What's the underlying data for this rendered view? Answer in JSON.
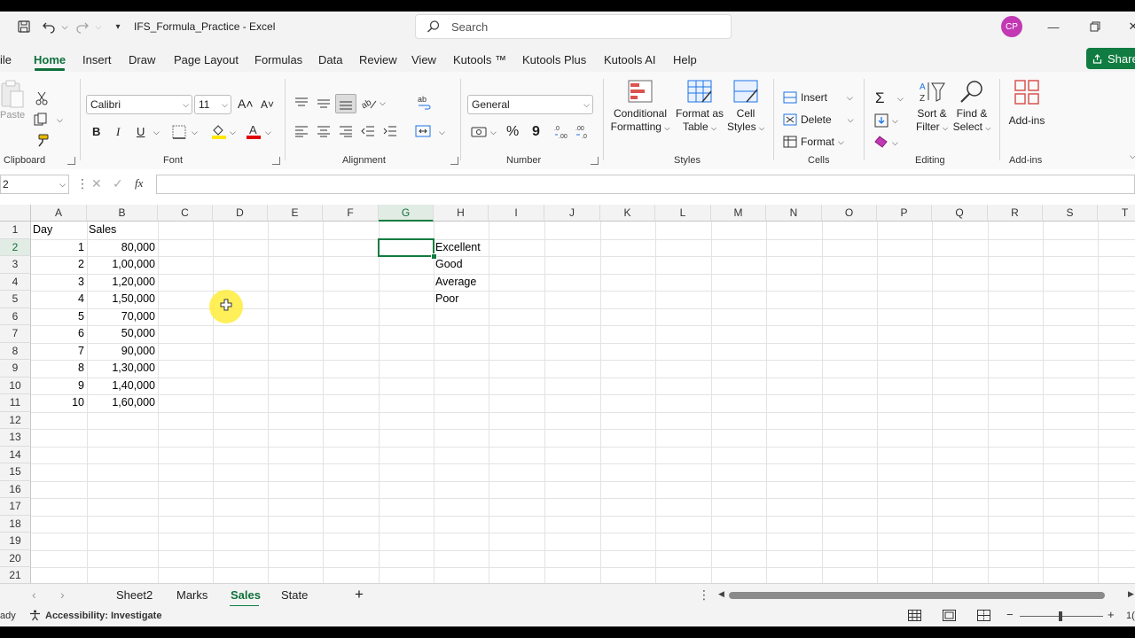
{
  "titlebar": {
    "doc_title": "IFS_Formula_Practice  -  Excel",
    "search_placeholder": "Search",
    "avatar_initials": "CP"
  },
  "menu": {
    "tabs": [
      "ile",
      "Home",
      "Insert",
      "Draw",
      "Page Layout",
      "Formulas",
      "Data",
      "Review",
      "View",
      "Kutools ™",
      "Kutools Plus",
      "Kutools AI",
      "Help"
    ],
    "active": "Home",
    "share_label": "Share"
  },
  "ribbon": {
    "clipboard": {
      "label": "Clipboard",
      "paste": "Paste"
    },
    "font": {
      "label": "Font",
      "name": "Calibri",
      "size": "11",
      "bold": "B",
      "italic": "I",
      "underline": "U",
      "grow": "A˄",
      "shrink": "A˅"
    },
    "alignment": {
      "label": "Alignment"
    },
    "number": {
      "label": "Number",
      "format": "General",
      "percent": "%",
      "comma": "9"
    },
    "styles": {
      "label": "Styles",
      "conditional_formatting_line1": "Conditional",
      "conditional_formatting_line2": "Formatting",
      "format_as_table_line1": "Format as",
      "format_as_table_line2": "Table",
      "cell_styles_line1": "Cell",
      "cell_styles_line2": "Styles"
    },
    "cells": {
      "label": "Cells",
      "insert": "Insert",
      "delete": "Delete",
      "format": "Format"
    },
    "editing": {
      "label": "Editing",
      "sort_filter_line1": "Sort &",
      "sort_filter_line2": "Filter",
      "find_select_line1": "Find &",
      "find_select_line2": "Select"
    },
    "addins": {
      "label": "Add-ins",
      "button": "Add-ins"
    }
  },
  "formula_bar": {
    "name_box": "2",
    "fx": "fx",
    "content": ""
  },
  "grid": {
    "columns": [
      "A",
      "B",
      "C",
      "D",
      "E",
      "F",
      "G",
      "H",
      "I",
      "J",
      "K",
      "L",
      "M",
      "N",
      "O",
      "P",
      "Q",
      "R",
      "S",
      "T"
    ],
    "selected_column": "G",
    "rows": [
      "1",
      "2",
      "3",
      "4",
      "5",
      "6",
      "7",
      "8",
      "9",
      "10",
      "11",
      "12",
      "13",
      "14",
      "15",
      "16",
      "17",
      "18",
      "19",
      "20",
      "21"
    ],
    "selected_row": "2",
    "header_day": "Day",
    "header_sales": "Sales",
    "days": [
      "1",
      "2",
      "3",
      "4",
      "5",
      "6",
      "7",
      "8",
      "9",
      "10"
    ],
    "sales": [
      "80,000",
      "1,00,000",
      "1,20,000",
      "1,50,000",
      "70,000",
      "50,000",
      "90,000",
      "1,30,000",
      "1,40,000",
      "1,60,000"
    ],
    "ratings": [
      "Excellent",
      "Good",
      "Average",
      "Poor"
    ]
  },
  "sheets": {
    "tabs": [
      "Sheet2",
      "Marks",
      "Sales",
      "State"
    ],
    "active": "Sales",
    "add": "+"
  },
  "status": {
    "ready": "ady",
    "accessibility": "Accessibility: Investigate",
    "zoom_partial": "1("
  }
}
